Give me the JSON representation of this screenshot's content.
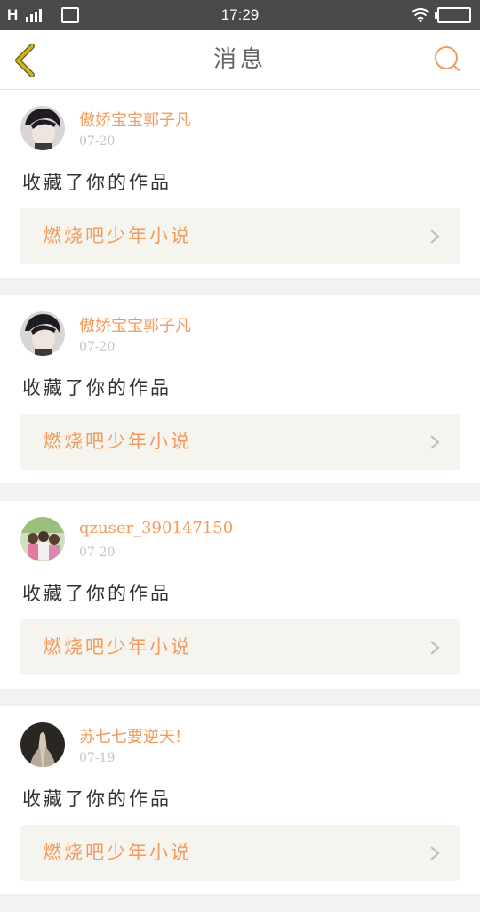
{
  "status_bar": {
    "carrier": "H",
    "time": "17:29"
  },
  "nav": {
    "title": "消息",
    "back_icon": "chevron-left-icon",
    "search_icon": "search-icon"
  },
  "colors": {
    "accent": "#f39a5c",
    "back_chevron": "#d6b400",
    "card_link_bg": "#f5f4ee"
  },
  "notifications": [
    {
      "username": "傲娇宝宝郭子凡",
      "date": "07-20",
      "action": "收藏了你的作品",
      "work_title": "燃烧吧少年小说"
    },
    {
      "username": "傲娇宝宝郭子凡",
      "date": "07-20",
      "action": "收藏了你的作品",
      "work_title": "燃烧吧少年小说"
    },
    {
      "username": "qzuser_390147150",
      "date": "07-20",
      "action": "收藏了你的作品",
      "work_title": "燃烧吧少年小说"
    },
    {
      "username": "苏七七要逆天!",
      "date": "07-19",
      "action": "收藏了你的作品",
      "work_title": "燃烧吧少年小说"
    }
  ]
}
